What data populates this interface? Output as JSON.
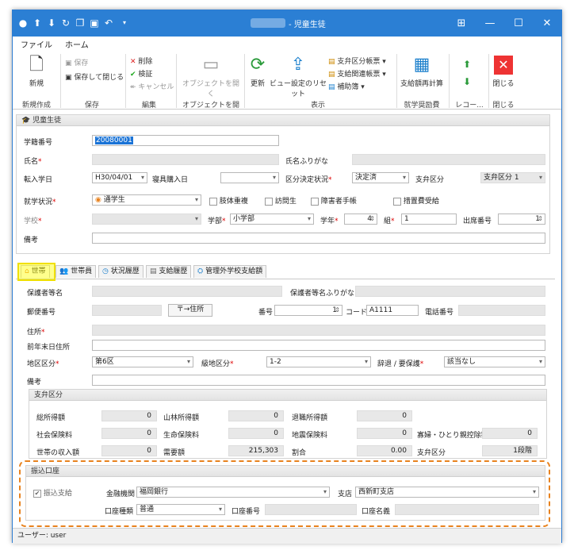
{
  "window": {
    "title": "- 児童生徒",
    "title_prefix_blurred": "",
    "controls": {
      "restore": "⊞",
      "minimize": "—",
      "maximize": "☐",
      "close": "✕"
    }
  },
  "menu": {
    "file": "ファイル",
    "home": "ホーム"
  },
  "ribbon": {
    "new_label": "新規",
    "save": "保存",
    "save_close": "保存して閉じる",
    "delete": "削除",
    "verify": "検証",
    "cancel": "キャンセル",
    "open_object": "オブジェクトを開く",
    "refresh": "更新",
    "reset_view": "ビュー設定のリセット",
    "payment_books": "支弁区分帳票",
    "payment_related": "支給関連帳票",
    "aid_books": "補助簿",
    "recalc": "支給額再計算",
    "close": "閉じる",
    "groups": {
      "new": "新規作成",
      "save": "保存",
      "edit": "編集",
      "object": "オブジェクトを開く",
      "display": "表示",
      "aid": "就学奨励費",
      "record": "レコー...",
      "close": "閉じる"
    }
  },
  "student": {
    "section_title": "児童生徒",
    "reg_no_label": "学籍番号",
    "reg_no": "20080001",
    "name_label": "氏名",
    "name_kana_label": "氏名ふりがな",
    "transfer_date_label": "転入学日",
    "transfer_date": "H30/04/01",
    "dorm_date_label": "寝具購入日",
    "decision_label": "区分決定状況",
    "decision": "決定済",
    "payment_cat_label": "支弁区分",
    "payment_cat": "支弁区分 1",
    "status_label": "就学状況",
    "status": "通学生",
    "checks": [
      "father_dup",
      "visit",
      "disability",
      "measure"
    ],
    "check_labels": {
      "father_dup": "肢体重複",
      "visit": "訪問生",
      "disability": "障害者手帳",
      "measure": "措置費受給"
    },
    "school_label": "学校",
    "dept_label": "学部",
    "dept": "小学部",
    "grade_label": "学年",
    "grade": "4",
    "class_label": "組",
    "class": "1",
    "att_no_label": "出席番号",
    "att_no": "1",
    "note_label": "備考"
  },
  "tabs": [
    "世帯",
    "世帯員",
    "状況履歴",
    "支給履歴",
    "管理外学校支給額"
  ],
  "household": {
    "guardian_label": "保護者等名",
    "guardian_kana_label": "保護者等名ふりがな",
    "postal_label": "郵便番号",
    "postal_btn": "〒→住所",
    "number_label": "番号",
    "number": "1",
    "code_label": "コード",
    "code": "A1111",
    "phone_label": "電話番号",
    "address_label": "住所",
    "prev_address_label": "前年末日住所",
    "area_label": "地区区分",
    "area": "第6区",
    "grade_area_label": "級地区分",
    "grade_area": "1-2",
    "withdraw_label": "辞退 / 要保護",
    "withdraw": "該当なし",
    "note_label": "備考"
  },
  "payment": {
    "section_title": "支弁区分",
    "rows": [
      [
        {
          "label": "総所得額",
          "value": "0"
        },
        {
          "label": "山林所得額",
          "value": "0"
        },
        {
          "label": "退職所得額",
          "value": "0"
        }
      ],
      [
        {
          "label": "社会保険料",
          "value": "0"
        },
        {
          "label": "生命保険料",
          "value": "0"
        },
        {
          "label": "地震保険料",
          "value": "0"
        },
        {
          "label": "寡婦・ひとり親控除額",
          "value": "0"
        }
      ],
      [
        {
          "label": "世帯の収入額",
          "value": "0"
        },
        {
          "label": "需要額",
          "value": "215,303"
        },
        {
          "label": "割合",
          "value": "0.00"
        },
        {
          "label": "支弁区分",
          "value": "1段階"
        }
      ]
    ]
  },
  "bank": {
    "section_title": "振込口座",
    "transfer_label": "振込支給",
    "bank_label": "金融機関",
    "bank": "福岡銀行",
    "branch_label": "支店",
    "branch": "西新町支店",
    "type_label": "口座種類",
    "type": "普通",
    "acct_no_label": "口座番号",
    "acct_name_label": "口座名義"
  },
  "status_bar": {
    "user": "ユーザー: user"
  },
  "colors": {
    "title_bar": "#2b7fd4",
    "highlight_tab": "#ffff00",
    "callout": "#e8821e"
  }
}
